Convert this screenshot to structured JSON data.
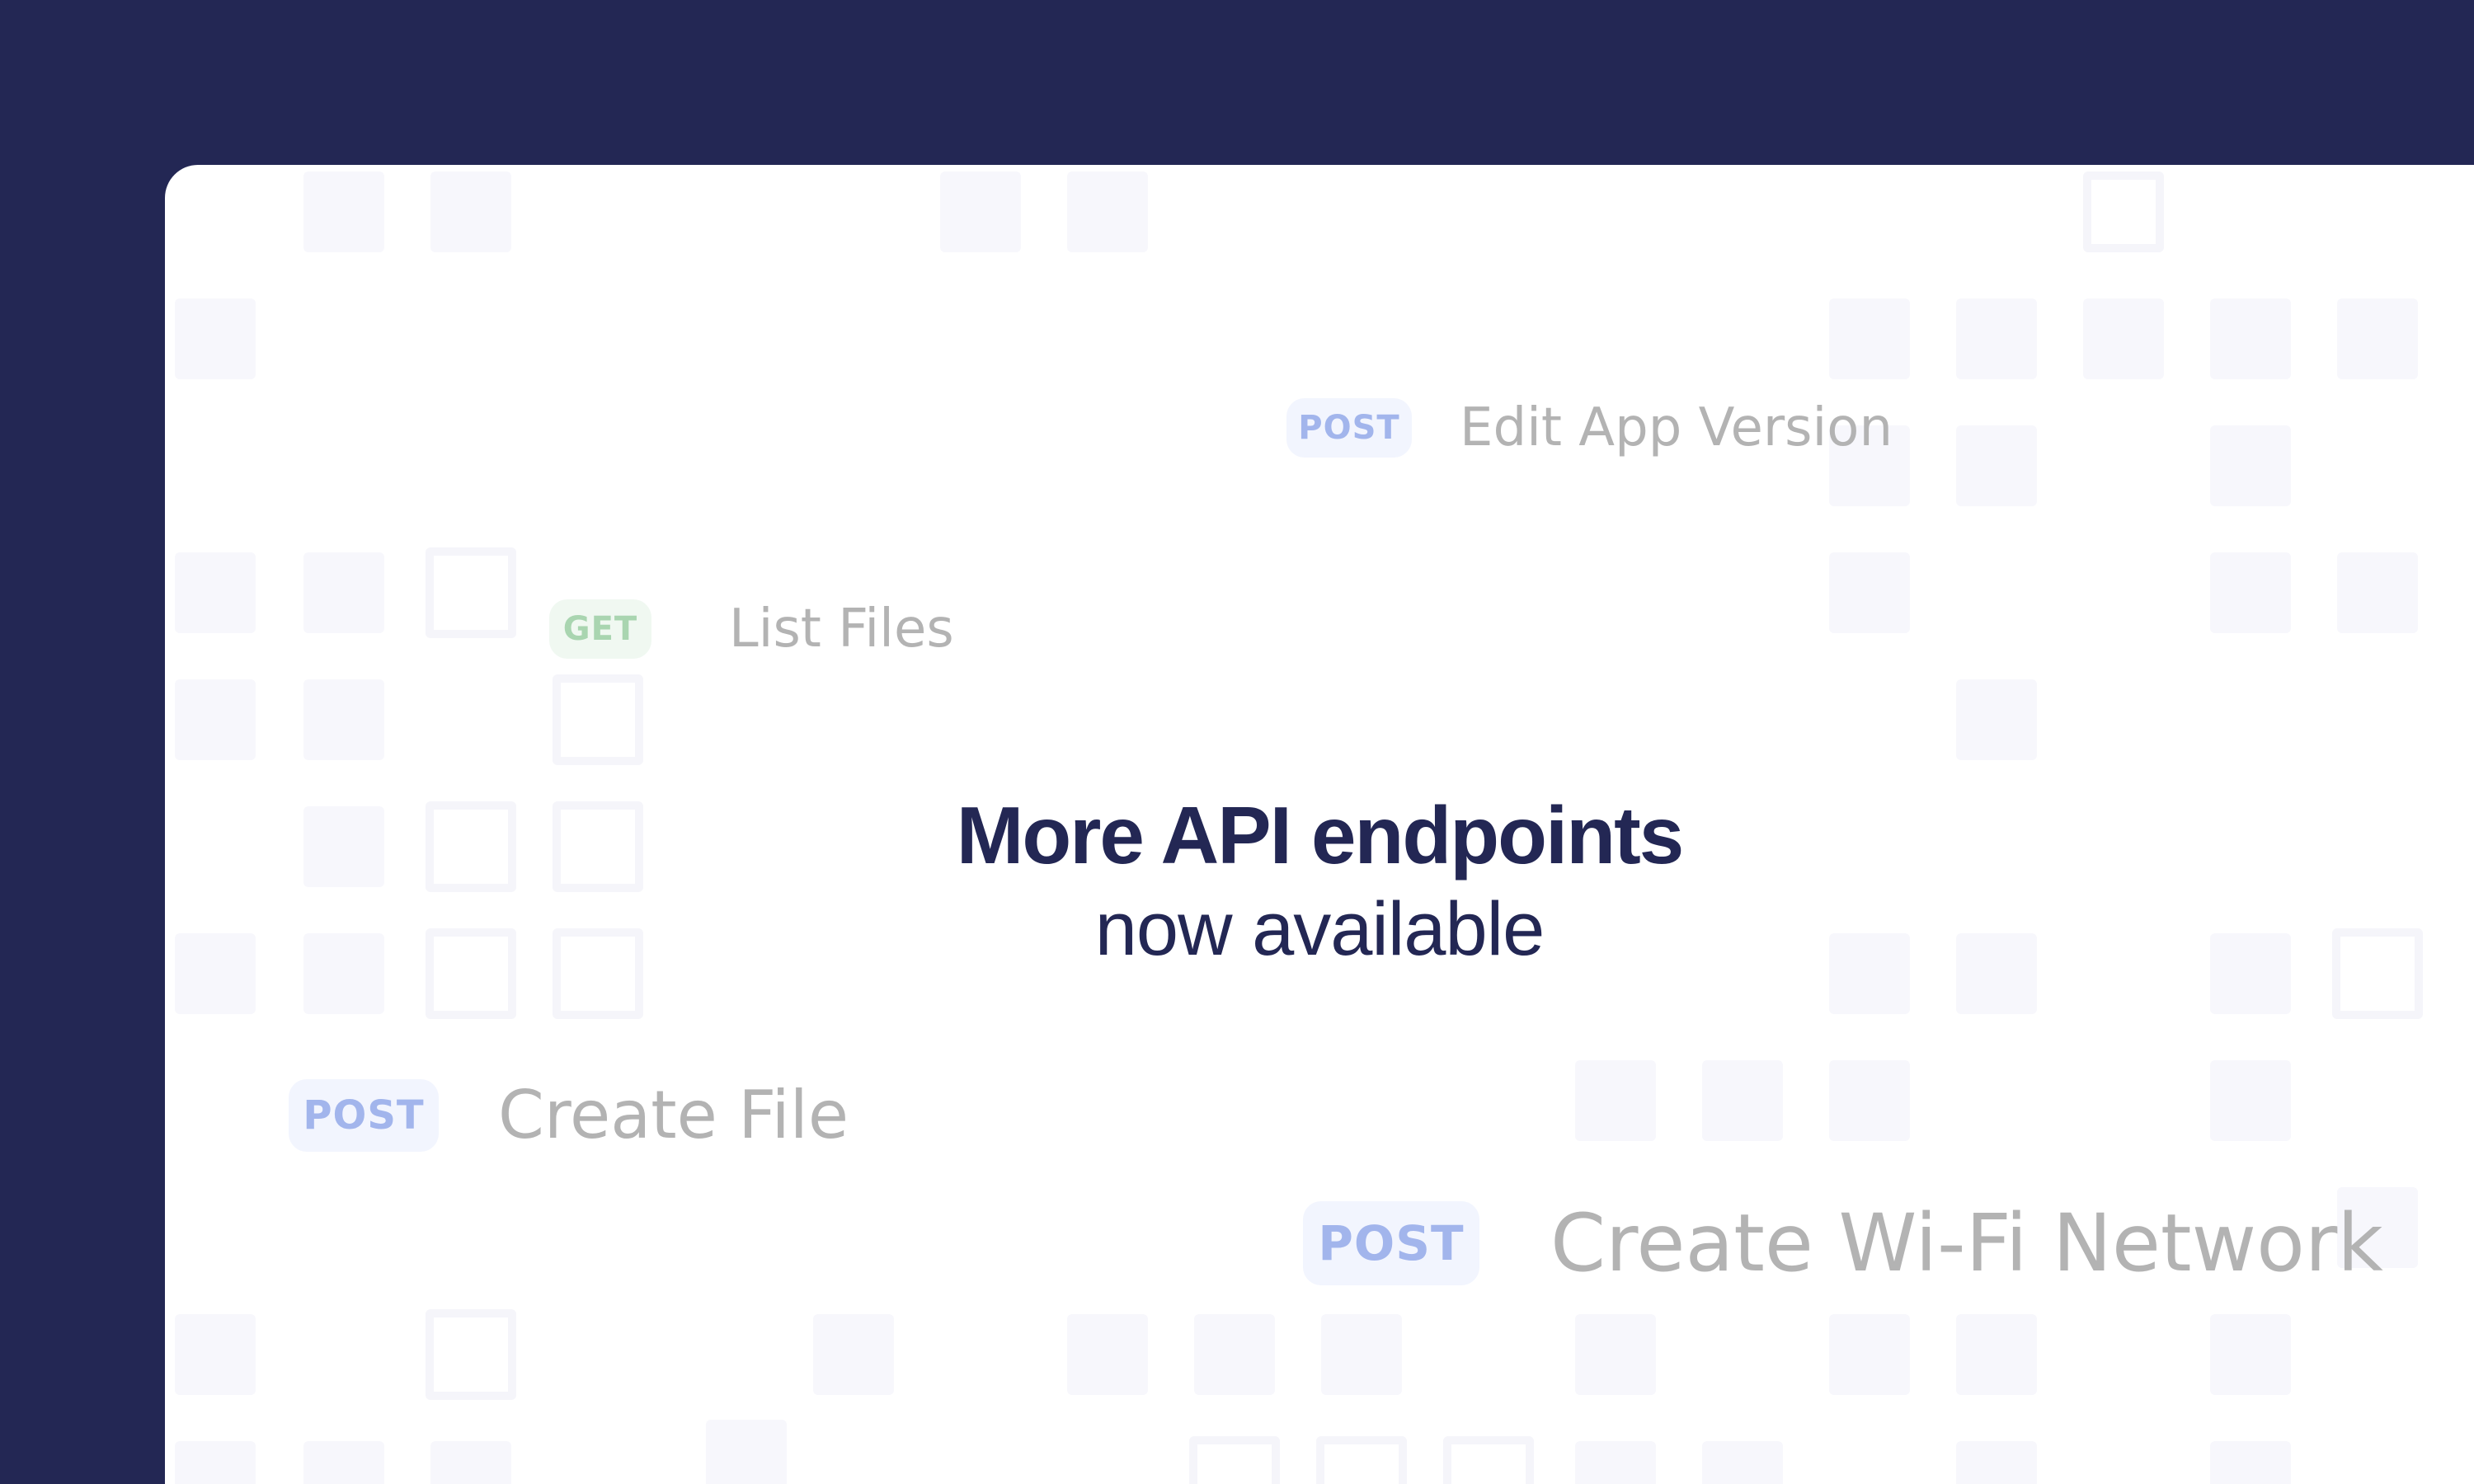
{
  "colors": {
    "background": "#232754",
    "card": "#ffffff",
    "headline": "#232754",
    "post_badge_text": "#a2b5ec",
    "post_badge_bg": "#f2f5fe",
    "get_badge_text": "#a9d5b0",
    "get_badge_bg": "#f0f8f1",
    "endpoint_text": "#b3b3b3",
    "tile": "#f7f7fc"
  },
  "headline": {
    "title": "More API endpoints",
    "subtitle": "now available"
  },
  "endpoints": [
    {
      "method": "POST",
      "label": "Edit App Version"
    },
    {
      "method": "GET",
      "label": "List Files"
    },
    {
      "method": "POST",
      "label": "Create File"
    },
    {
      "method": "POST",
      "label": "Create Wi-Fi Network"
    }
  ]
}
